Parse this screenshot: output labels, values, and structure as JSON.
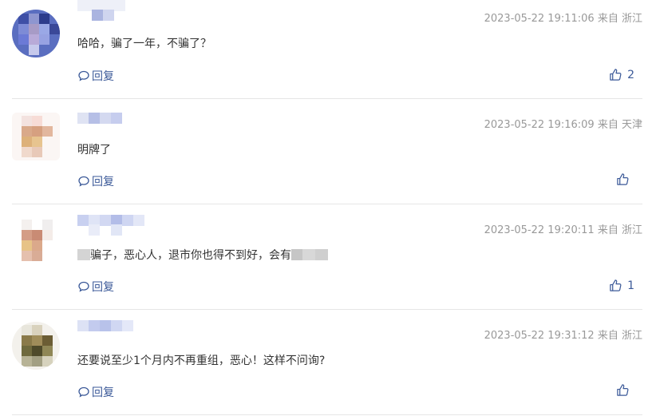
{
  "comments": [
    {
      "timestamp": "2023-05-22 19:11:06",
      "location_prefix": "来自",
      "location": "浙江",
      "text": "哈哈，骗了一年，不骗了？",
      "text_after_mosaic": "",
      "reply_label": "回复",
      "likes": "2"
    },
    {
      "timestamp": "2023-05-22 19:16:09",
      "location_prefix": "来自",
      "location": "天津",
      "text": "明牌了",
      "text_after_mosaic": "",
      "reply_label": "回复",
      "likes": ""
    },
    {
      "timestamp": "2023-05-22 19:20:11",
      "location_prefix": "来自",
      "location": "浙江",
      "text": "骗子，恶心人，退市你也得不到好，会有",
      "text_after_mosaic": "",
      "reply_label": "回复",
      "likes": "1"
    },
    {
      "timestamp": "2023-05-22 19:31:12",
      "location_prefix": "来自",
      "location": "浙江",
      "text": "还要说至少1个月内不再重组，恶心！这样不问询?",
      "text_after_mosaic": "",
      "reply_label": "回复",
      "likes": ""
    }
  ],
  "colors": {
    "link": "#3b5998",
    "meta": "#999999",
    "separator": "#e6e6e6"
  },
  "icons": {
    "reply": "speech-bubble-icon",
    "like": "thumbs-up-icon"
  }
}
